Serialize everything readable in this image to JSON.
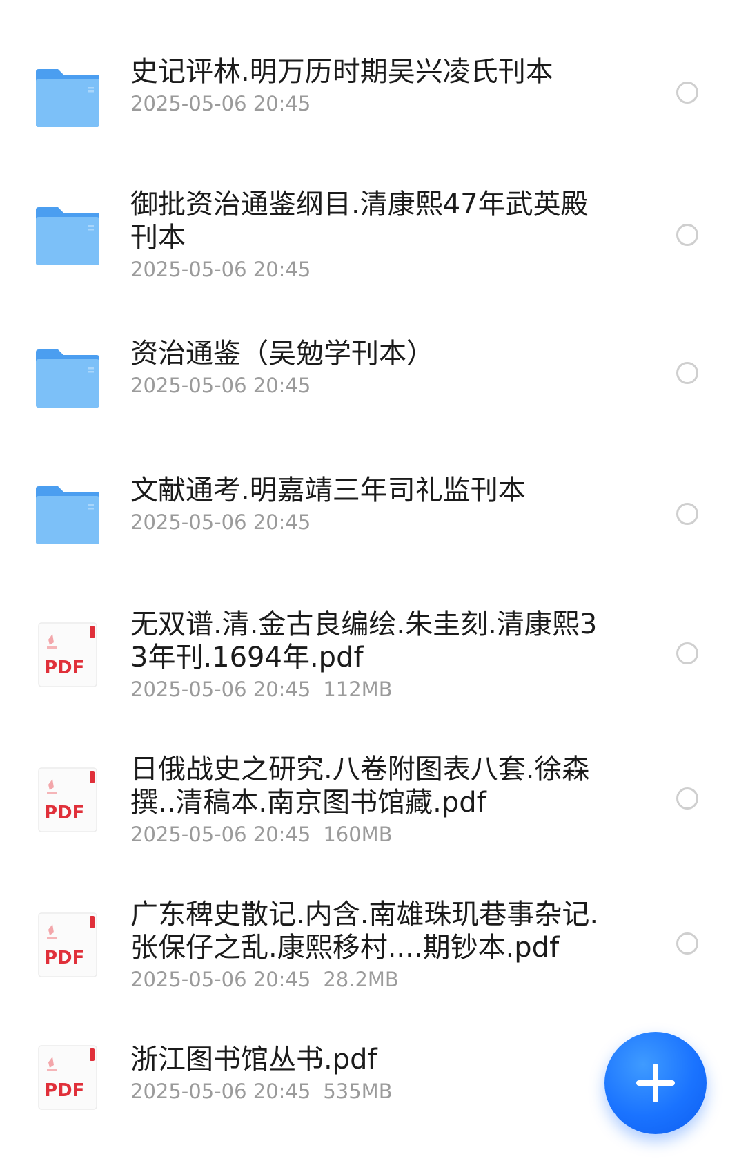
{
  "files": [
    {
      "type": "folder",
      "icon": "folder-icon",
      "name": "史记评林.明万历时期吴兴凌氏刊本",
      "date": "2025-05-06 20:45",
      "size": ""
    },
    {
      "type": "folder",
      "icon": "folder-icon",
      "name": "御批资治通鉴纲目.清康熙47年武英殿刊本",
      "date": "2025-05-06 20:45",
      "size": ""
    },
    {
      "type": "folder",
      "icon": "folder-icon",
      "name": "资治通鉴（吴勉学刊本）",
      "date": "2025-05-06 20:45",
      "size": ""
    },
    {
      "type": "folder",
      "icon": "folder-icon",
      "name": "文献通考.明嘉靖三年司礼监刊本",
      "date": "2025-05-06 20:45",
      "size": ""
    },
    {
      "type": "pdf",
      "icon": "pdf-file-icon",
      "icon_label": "PDF",
      "name": "无双谱.清.金古良编绘.朱圭刻.清康熙33年刊.1694年.pdf",
      "date": "2025-05-06 20:45",
      "size": "112MB"
    },
    {
      "type": "pdf",
      "icon": "pdf-file-icon",
      "icon_label": "PDF",
      "name": "日俄战史之研究.八卷附图表八套.徐森撰..清稿本.南京图书馆藏.pdf",
      "date": "2025-05-06 20:45",
      "size": "160MB"
    },
    {
      "type": "pdf",
      "icon": "pdf-file-icon",
      "icon_label": "PDF",
      "name": "广东稗史散记.内含.南雄珠玑巷事杂记.张保仔之乱.康熙移村....期钞本.pdf",
      "date": "2025-05-06 20:45",
      "size": "28.2MB"
    },
    {
      "type": "pdf",
      "icon": "pdf-file-icon",
      "icon_label": "PDF",
      "name": "浙江图书馆丛书.pdf",
      "date": "2025-05-06 20:45",
      "size": "535MB"
    }
  ],
  "fab": {
    "icon": "plus-icon",
    "color": "#1a73ff"
  },
  "colors": {
    "folder": "#6fb4f5",
    "pdf_red": "#e0303a",
    "name_text": "#1b1b1b",
    "meta_text": "#9b9b9b"
  }
}
